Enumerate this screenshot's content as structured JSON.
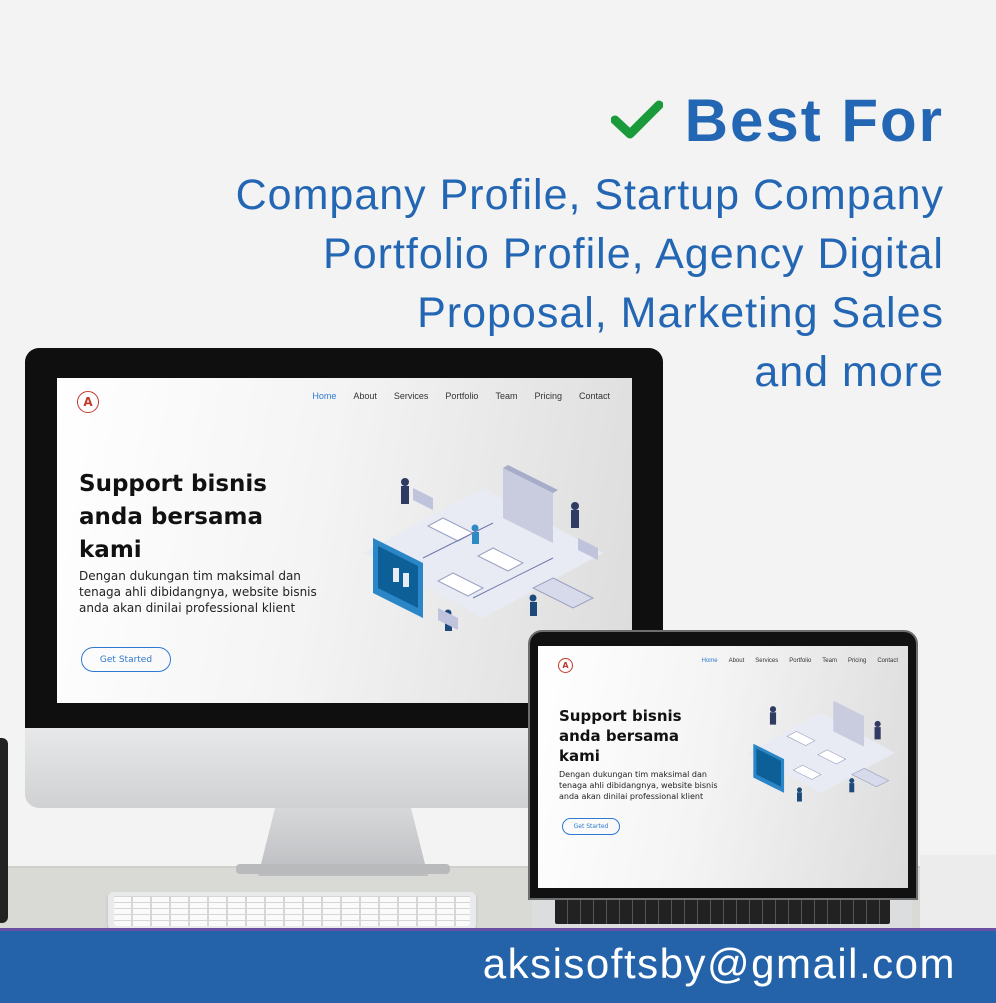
{
  "header": {
    "check_icon": "check-icon",
    "check_color": "#1a9a3a",
    "title": "Best For",
    "lines": [
      "Company Profile, Startup Company",
      "Portfolio Profile, Agency Digital",
      "Proposal, Marketing Sales",
      "and more"
    ],
    "accent_color": "#2366b3"
  },
  "website": {
    "logo": "A",
    "nav": [
      "Home",
      "About",
      "Services",
      "Portfolio",
      "Team",
      "Pricing",
      "Contact"
    ],
    "active_nav": "Home",
    "headline": [
      "Support bisnis",
      "anda bersama",
      "kami"
    ],
    "description": [
      "Dengan dukungan tim maksimal dan",
      "tenaga ahli dibidangnya, website bisnis",
      "anda akan dinilai professional klient"
    ],
    "cta_label": "Get Started",
    "illustration": "isometric-office-illustration"
  },
  "footer": {
    "email": "aksisoftsby@gmail.com",
    "background": "#2463a9"
  }
}
